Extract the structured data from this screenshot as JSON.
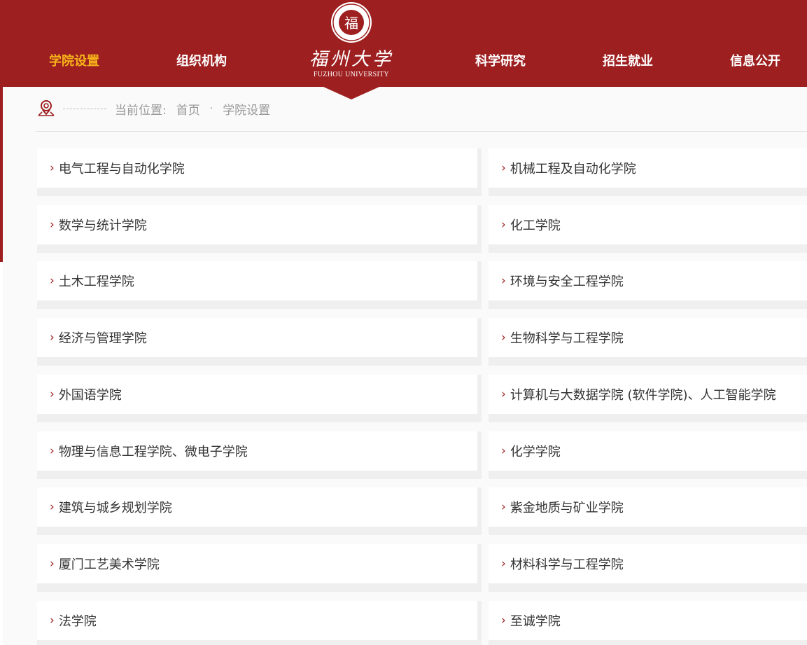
{
  "nav": {
    "items": [
      "学院设置",
      "组织机构",
      "科学研究",
      "招生就业",
      "信息公开"
    ]
  },
  "logo": {
    "seal_char": "福",
    "cn_name": "福州大学",
    "en_name": "FUZHOU UNIVERSITY"
  },
  "breadcrumb": {
    "prefix": "当前位置:",
    "home": "首页",
    "separator": "·",
    "current": "学院设置"
  },
  "colleges": {
    "left": [
      "电气工程与自动化学院",
      "数学与统计学院",
      "土木工程学院",
      "经济与管理学院",
      "外国语学院",
      "物理与信息工程学院、微电子学院",
      "建筑与城乡规划学院",
      "厦门工艺美术学院",
      "法学院"
    ],
    "right": [
      "机械工程及自动化学院",
      "化工学院",
      "环境与安全工程学院",
      "生物科学与工程学院",
      "计算机与大数据学院 (软件学院)、人工智能学院",
      "化学学院",
      "紫金地质与矿业学院",
      "材料科学与工程学院",
      "至诚学院"
    ]
  },
  "colors": {
    "brand_red": "#9e1f20",
    "active_nav": "#f5b21a"
  }
}
